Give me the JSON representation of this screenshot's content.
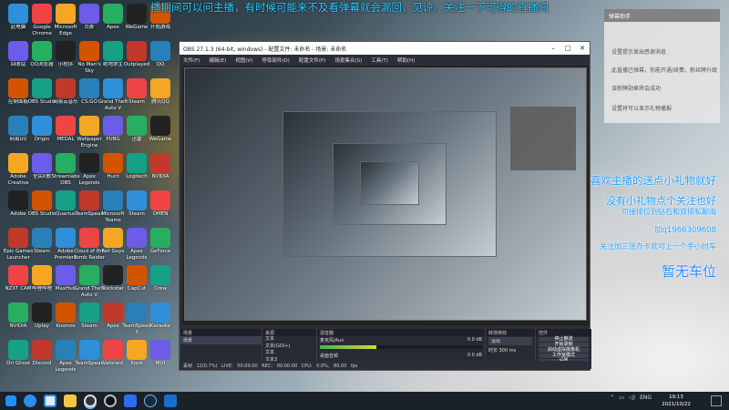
{
  "ticker": "播期间可以问主播，有时候可能来不及看弹幕就会漏回，见谅。关注一下可得的直播间",
  "chat_panel": {
    "title": "弹幕助手",
    "lines": [
      "设置提示发出感谢消息",
      "此直播已弹幕，你能开通/续费，粉丝牌升级",
      "该粉牌勋章将会成功",
      "设置将可以显示礼物播报"
    ]
  },
  "danmaku": [
    "喜欢主播的送点小礼物就好",
    "没有小礼物点个关注也好",
    "可接排位到钻石和双排私聊海",
    "加q1966309608",
    "关注加三张办卡就可上一个手小时车",
    "暂无车位"
  ],
  "desktop_icons": [
    [
      "此电脑",
      "Google Chrome",
      "Microsoft Edge",
      "D游",
      "Apex",
      "WeGame",
      "开始游戏"
    ],
    [
      "回收站",
      "QQ浏览器",
      "小程序",
      "No Man's Sky",
      "绝地求生",
      "Outplayed",
      "QQ"
    ],
    [
      "控制面板",
      "OBS Studio",
      "网易云音乐",
      "CS:GO",
      "Grand Theft Auto V",
      "Steam",
      "腾讯QQ"
    ],
    [
      "网易UU",
      "Origin",
      "MEDAL",
      "Wallpaper Engine",
      "PUBG",
      "迅雷",
      "WeGame"
    ],
    [
      "Adobe Creative",
      "全民K歌",
      "Streamlabs OBS",
      "Apex Legends",
      "Hunt",
      "Logitech",
      "NVIDIA"
    ],
    [
      "Adobe",
      "OBS Studio",
      "Quartus",
      "TeamSpeak",
      "Microsoft Teams",
      "Steam",
      "OMEN"
    ],
    [
      "Epic Games Launcher",
      "Steam",
      "Adobe Premiere",
      "Cloud of the Tomb Raider",
      "Fall Guys",
      "Apex Legends",
      "GeForce"
    ],
    [
      "NZXT CAM",
      "哔哩哔哩",
      "MaxHub",
      "Grand Theft Auto V",
      "Rockstar",
      "CapCut",
      "Crew"
    ],
    [
      "NVIDIA",
      "Uplay",
      "Kosmos",
      "Steam",
      "Apex",
      "TeamSpeak 3",
      "Karaoke"
    ],
    [
      "Ori Ghost",
      "Discord",
      "Apex Legends",
      "TeamSpeak",
      "Valorant",
      "Kook",
      "MUI"
    ]
  ],
  "obs": {
    "title": "OBS 27.1.3 (64-bit, windows) - 配置文件: 未命名 - 场景: 未命名",
    "menu": [
      "文件(F)",
      "编辑(E)",
      "视图(V)",
      "停靠部件(D)",
      "配置文件(P)",
      "场景集合(S)",
      "工具(T)",
      "帮助(H)"
    ],
    "scenes_header": "场景",
    "scenes": [
      "场景"
    ],
    "sources_header": "来源",
    "sources": [
      "文本",
      "文本(GDI+)",
      "文本",
      "文本3",
      "文本1",
      "文本2"
    ],
    "mixer_header": "混音器",
    "mixer": [
      {
        "label": "麦克风/Aux",
        "db": "0.0 dB",
        "level": 0.35
      },
      {
        "label": "桌面音频",
        "db": "0.0 dB",
        "level": 0.55
      }
    ],
    "transitions_header": "转场特效",
    "transition_type": "淡出",
    "duration_label": "时长",
    "duration_value": "300 ms",
    "controls_header": "控件",
    "controls": [
      "停止推流",
      "开始录制",
      "启动虚拟摄像机",
      "工作室模式",
      "设置",
      "退出"
    ],
    "status": "丢帧 12(0.7%)   LIVE: 00:00:00   REC: 00:00:00   CPU: 0.0%, 60.00 fps"
  },
  "taskbar": {
    "clock_time": "19:13",
    "clock_date": "2021/10/22",
    "lang": "ENG"
  }
}
